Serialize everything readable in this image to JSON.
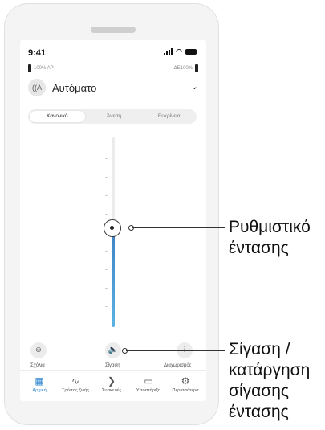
{
  "status": {
    "time": "9:41"
  },
  "hearing_aids": {
    "left": "100% AP",
    "right": "ΔΕ100%"
  },
  "program": {
    "icon": "sound-wave-icon",
    "name": "Αυτόματο"
  },
  "modes": [
    "Κανονικό",
    "Άνεση",
    "Ευκρίνεια"
  ],
  "volume_level": 0.5,
  "actions": {
    "comments": "Σχόλια",
    "mute": "Σίγαση",
    "adjust": "Διαχωρισμός"
  },
  "tabs": [
    "Αρχική",
    "Τρόπος ζωής",
    "Συσκευές",
    "Υποστήριξη",
    "Περισσότερα"
  ],
  "callouts": {
    "volume": [
      "Ρυθμιστικό",
      "έντασης"
    ],
    "mute": [
      "Σίγαση /",
      "κατάργηση",
      "σίγασης",
      "έντασης"
    ]
  },
  "colors": {
    "accent": "#2f86d0"
  }
}
